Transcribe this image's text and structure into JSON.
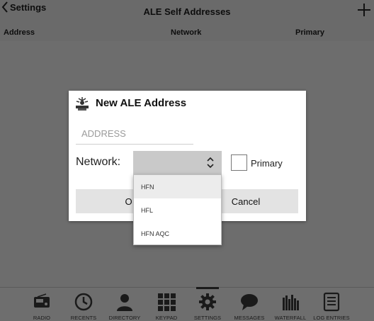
{
  "header": {
    "back_label": "Settings",
    "title": "ALE Self Addresses",
    "columns": [
      "Address",
      "Network",
      "Primary"
    ]
  },
  "dialog": {
    "title": "New ALE Address",
    "address_placeholder": "ADDRESS",
    "address_value": "",
    "network_label": "Network:",
    "network_value": "",
    "primary_label": "Primary",
    "primary_checked": false,
    "ok_label": "OK",
    "ok_label_visible": "O",
    "cancel_label": "Cancel"
  },
  "network_options": [
    {
      "label": "HFN",
      "highlighted": true
    },
    {
      "label": "HFL",
      "highlighted": false
    },
    {
      "label": "HFN AQC",
      "highlighted": false
    }
  ],
  "nav": {
    "items": [
      {
        "label": "RADIO",
        "icon": "radio-icon",
        "active": false
      },
      {
        "label": "RECENTS",
        "icon": "clock-icon",
        "active": false
      },
      {
        "label": "DIRECTORY",
        "icon": "person-icon",
        "active": false
      },
      {
        "label": "KEYPAD",
        "icon": "keypad-icon",
        "active": false
      },
      {
        "label": "SETTINGS",
        "icon": "gear-icon",
        "active": true
      },
      {
        "label": "MESSAGES",
        "icon": "chat-icon",
        "active": false
      },
      {
        "label": "WATERFALL",
        "icon": "waterfall-icon",
        "active": false
      },
      {
        "label": "LOG ENTRIES",
        "icon": "list-icon",
        "active": false
      }
    ]
  },
  "colors": {
    "background": "#6d6d6d",
    "dialog": "#ffffff",
    "select": "#c9c9c9",
    "button": "#e3e3e3"
  }
}
